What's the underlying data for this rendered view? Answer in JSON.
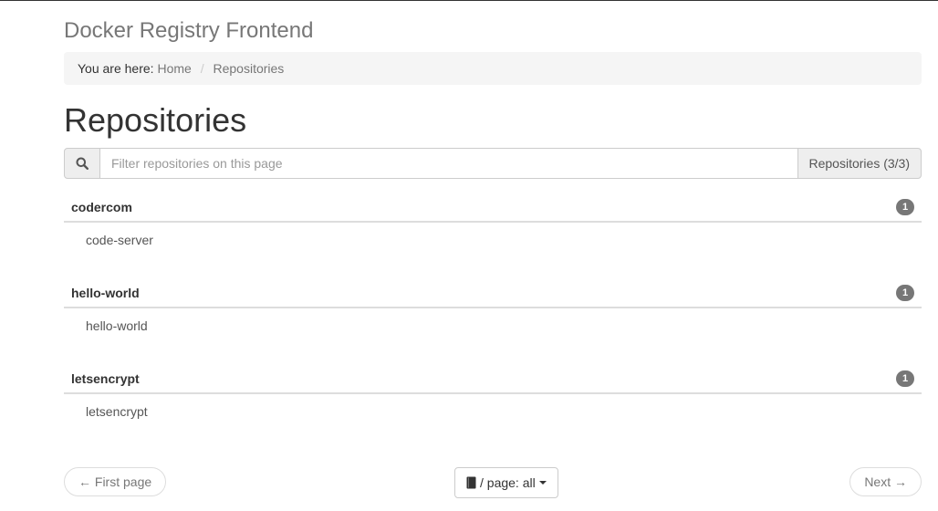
{
  "app": {
    "title": "Docker Registry Frontend"
  },
  "breadcrumb": {
    "prefix": "You are here:",
    "home": "Home",
    "separator": "/",
    "current": "Repositories"
  },
  "page": {
    "title": "Repositories"
  },
  "filter": {
    "placeholder": "Filter repositories on this page",
    "value": "",
    "icon": "search-icon",
    "count_label": "Repositories (3/3)"
  },
  "repositories": [
    {
      "namespace": "codercom",
      "count": "1",
      "items": [
        "code-server"
      ]
    },
    {
      "namespace": "hello-world",
      "count": "1",
      "items": [
        "hello-world"
      ]
    },
    {
      "namespace": "letsencrypt",
      "count": "1",
      "items": [
        "letsencrypt"
      ]
    }
  ],
  "pager": {
    "first_label": "← First page",
    "per_page_label": "/ page: all",
    "per_page_icon": "book-icon",
    "next_label": "Next →"
  },
  "colors": {
    "badge": "#777777",
    "breadcrumb_bg": "#f5f5f5"
  }
}
